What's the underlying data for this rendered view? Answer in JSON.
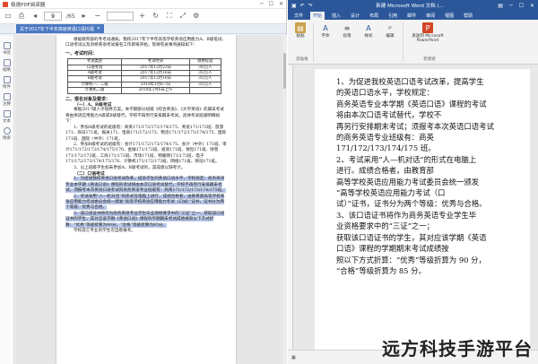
{
  "pdf": {
    "window_title": "极速PDF阅读器",
    "toolbar": {
      "page_current": "9",
      "page_total": "/65",
      "zoom": ""
    },
    "tab_title": "关于2017年下半年高级英语口语托福",
    "sidebar": [
      "书签",
      "缩略",
      "附件",
      "注释",
      "文本",
      "搜索"
    ],
    "page": {
      "intro": "根据教育部的专考试通知，我校2017年下半年高等学校英语应用能力A、B级笔试、口语考试以及剑桥英语考试报名工作即将开始，现将有关事项通知如下：",
      "h_section": "一、考试时间：",
      "table": {
        "headers": [
          "考试类别",
          "考试时间",
          "收费标准"
        ],
        "rows": [
          [
            "口语考试",
            "2017年12月23日",
            "30元/人"
          ],
          [
            "A级考试",
            "2017年12月16日",
            "35元/人"
          ],
          [
            "B级考试",
            "2017年12月16日",
            "35元/人"
          ],
          [
            "计算机一、二级",
            "2018年1月6-7日",
            "35元/人"
          ],
          [
            "计算机二级",
            "2018年1月6日上午",
            ""
          ]
        ]
      },
      "h_section2": "二、报名对象及要求：",
      "h_sub1": "（一）A、B级考试",
      "para1": "根据2017级人才培养方案，本学期部分班级《综合英语》、《大学英语》的期末考试将由英语应用能力A级或B级替代，学校不再另行安排期末考试。具体考试班级明细如下：",
      "para2": "1、参加A级考试的班级有：商英171/172/173/174/175、英语171/172班、旅游171、商日171班、报关171、电商171/172/173、物流171/172/173/174/175、国际171班、国际（中外）171班。",
      "para3": "2、参加B级考试的班级有：会计171/172/173/174/175、会计（中外）171班、审计171/172/173/174/175/176、金融171/172班、投资171班、保险171班、财管171/172/173班、工商171/172班、市场171班、物联网171/172班、电子171/172/173/174/175/176、计算机171/172/173班、网络171班、移动171班。",
      "para4": "3、以上班级学生如未参加A、B级考试的，其成绩以缺考计。",
      "h_sub2": "（二）口语考试",
      "para5": "1、为促进我校英语口语考试改革，提高学生的英语口语水平，学校规定：商务英语专业本学期《英语口语》课程的考试将由本次口语考试替代，学校不再另行安排期末考试，须报考本次英语口语考试的商务英语专业班级有：商英171/172/173/174/175班。",
      "para6": "2、考试采用“人—机对话”的形式在电脑上进行，成绩合格者，由教育部高等学校英语应用能力考试委员会统一颁发“高等学校英语应用能力考试（口试）”证书，证书分为两个等级：优秀与合格。",
      "para7": "3、该口语证书将作为商务英语专业学生毕业资格要求中的“三证”之一，获取该口语证书的学生，其对应该学期《英语口语》课程的学期期末考试成绩按照以下方式折算：“优秀”等级折算为90分，“合格”等级折算为85分。",
      "para8": "学校其它专业的学生可自愿报考。"
    }
  },
  "word": {
    "doc_title": "新建 Microsoft Word 文档 (...",
    "tabs": [
      "文件",
      "开始",
      "插入",
      "设计",
      "布局",
      "引用",
      "邮件",
      "审阅",
      "视图",
      "帮助"
    ],
    "active_tab": "开始",
    "ribbon": {
      "groups": [
        {
          "label": "剪贴板",
          "buttons": [
            "粘贴"
          ]
        },
        {
          "label": "",
          "buttons": [
            "字体",
            "段落",
            "样式",
            "编辑"
          ]
        },
        {
          "label": "新建组",
          "buttons": [
            "发送到 Microsoft PowerPoint"
          ]
        }
      ]
    },
    "page": {
      "lines": [
        "1、为促进我校英语口语考试改革，提高学生",
        "的英语口语水平，学校规定：",
        "商务英语专业本学期《英语口语》课程的考试",
        "将由本次口语考试替代，学校不",
        "再另行安排期末考试；须报考本次英语口语考试",
        "的商务英语专业班级有：商英",
        "171/172/173/174/175 班。",
        "2、考试采用“人—机对话”的形式在电脑上",
        "进行。成绩合格者，由教育部",
        "高等学校英语应用能力考试委员会统一颁发",
        "“高等学校英语应用能力考试（口",
        "试）”证书，证书分为两个等级：优秀与合格。",
        "3、该口语证书将作为商务英语专业学生毕",
        "业资格要求中的“三证”之一；",
        "获取该口语证书的学生，其对应该学期《英语",
        "口语》课程的学期期末考试成绩按",
        "照以下方式折算：“优秀”等级折算为 90 分，",
        "“合格”等级折算为 85 分。"
      ]
    }
  },
  "watermark": "远方科技手游平台"
}
